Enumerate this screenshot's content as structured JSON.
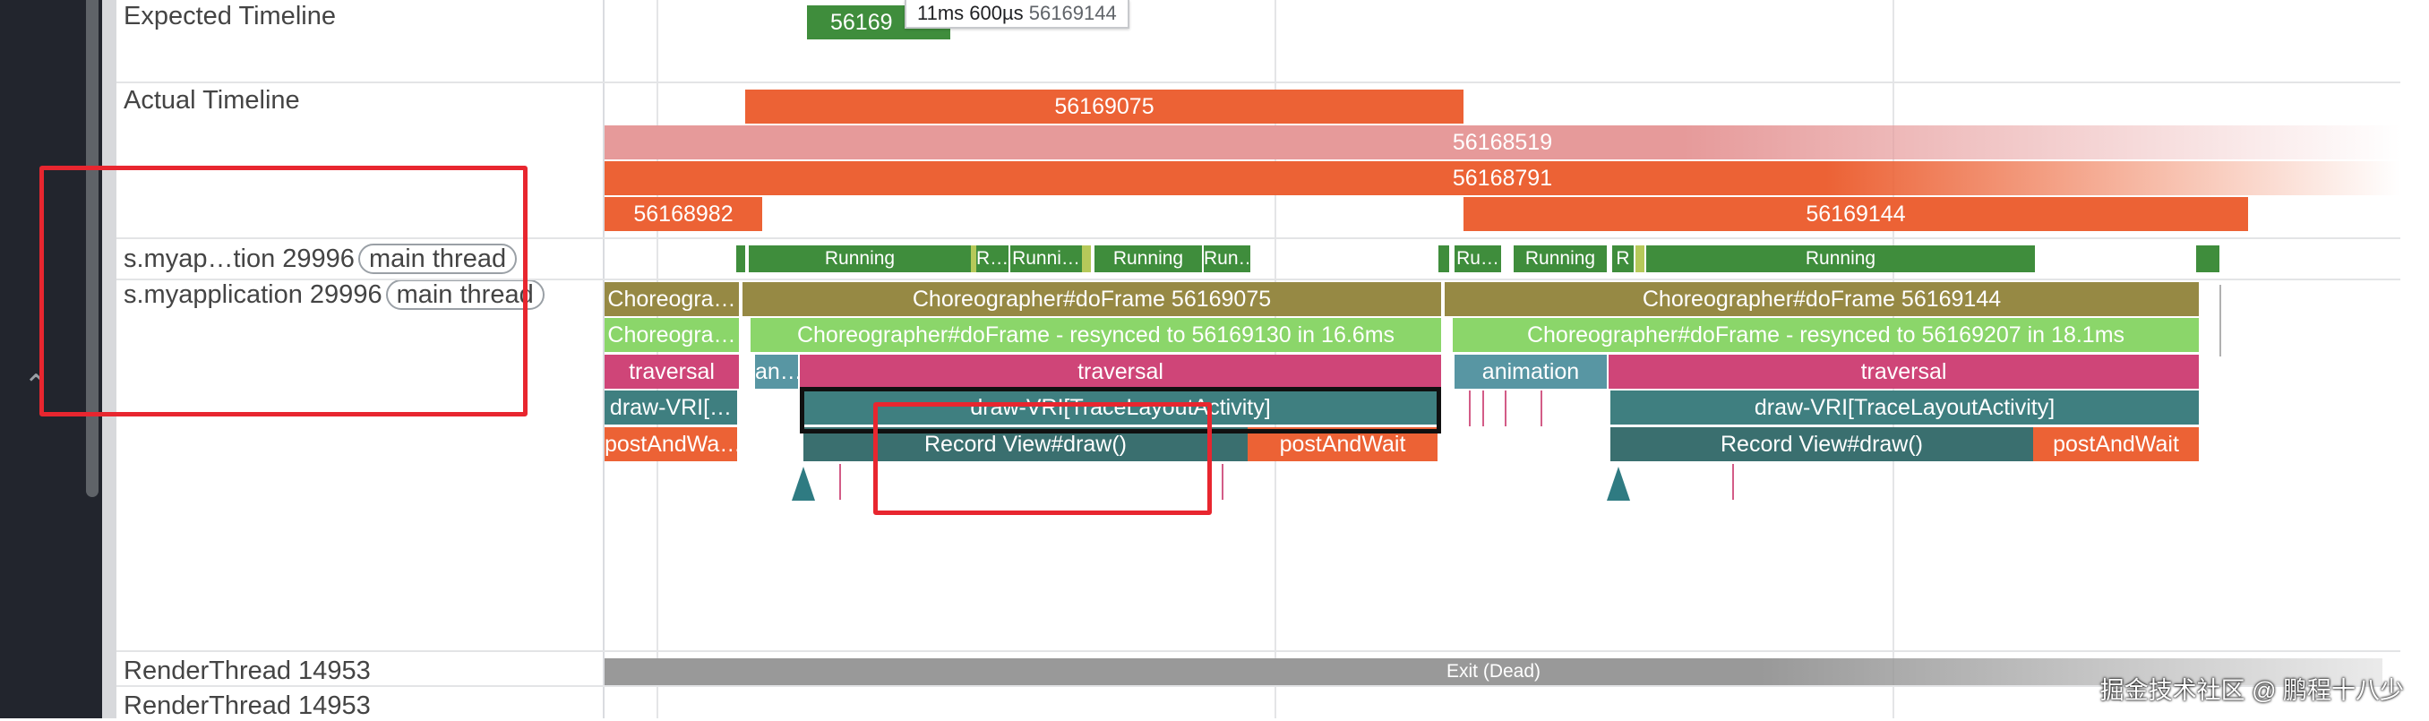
{
  "tooltip": {
    "duration": "11ms 600µs",
    "id": "56169144"
  },
  "tracks": {
    "expected": "Expected Timeline",
    "actual": "Actual Timeline",
    "thread_short": "s.myap…tion 29996",
    "thread_full": "s.myapplication 29996",
    "main_chip": "main thread",
    "render1": "RenderThread 14953",
    "render2": "RenderThread 14953"
  },
  "expected_slices": [
    "56169"
  ],
  "actual_slices": [
    "56169075",
    "56168519",
    "56168791",
    "56168982",
    "56169144"
  ],
  "state_slices": [
    "Running",
    "R…",
    "Runni…",
    "Running",
    "Run…",
    "Ru…",
    "Running",
    "R",
    "Running"
  ],
  "frame_slices": {
    "row1": [
      "Choreogra…",
      "Choreographer#doFrame 56169075",
      "Choreographer#doFrame 56169144"
    ],
    "row2": [
      "Choreogra…",
      "Choreographer#doFrame - resynced to 56169130 in 16.6ms",
      "Choreographer#doFrame - resynced to 56169207 in 18.1ms"
    ],
    "row3": [
      "traversal",
      "an…",
      "traversal",
      "animation",
      "traversal"
    ],
    "row4": [
      "draw-VRI[…",
      "draw-VRI[TraceLayoutActivity]",
      "draw-VRI[TraceLayoutActivity]"
    ],
    "row5": [
      "postAndWa…",
      "Record View#draw()",
      "postAndWait",
      "Record View#draw()",
      "postAndWait"
    ]
  },
  "render_state": "Exit (Dead)",
  "watermark": "掘金技术社区 @ 鹏程十八少",
  "colors": {
    "orange": "#ec6235",
    "pink_fade": "#e69a9a",
    "green_dark": "#3f8d3c",
    "olive": "#968944",
    "light_green": "#8bd66a",
    "magenta": "#cf4578",
    "teal": "#3f7f80",
    "teal_light": "#5896a3",
    "annotation_red": "#e8262f"
  }
}
